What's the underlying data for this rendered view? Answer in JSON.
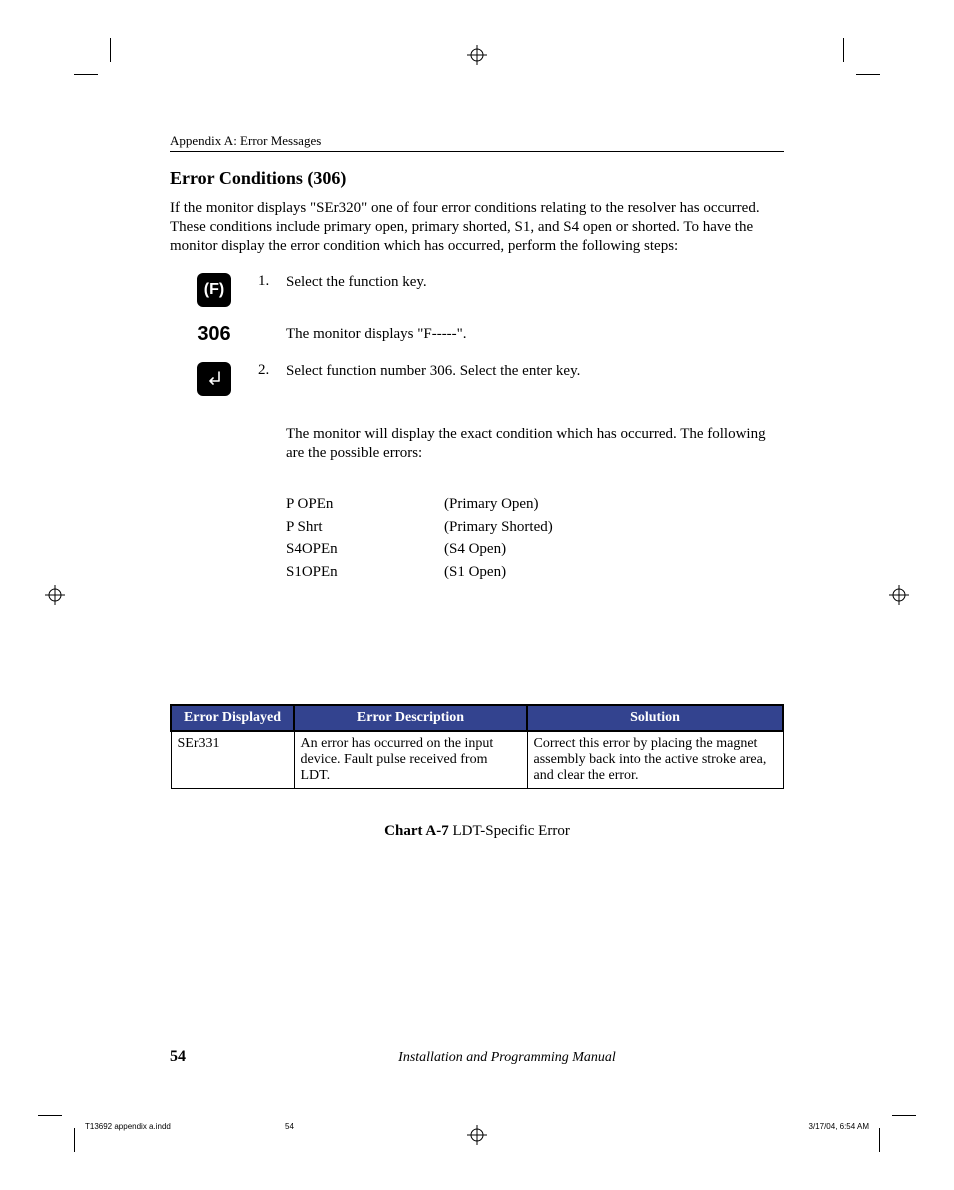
{
  "header": "Appendix A:  Error Messages",
  "section_title": "Error Conditions (306)",
  "intro": "If the monitor displays \"SEr320\" one of four error conditions relating to the resolver has occurred. These conditions include primary open, primary shorted, S1, and S4 open or shorted. To have the monitor display the error condition which has occurred, perform the following steps:",
  "icons": {
    "f_label": "(F)",
    "code_306": "306"
  },
  "steps": {
    "s1_num": "1.",
    "s1_text": "Select the function key.",
    "s1_result": "The monitor displays \"F-----\".",
    "s2_num": "2.",
    "s2_text": "Select function number 306. Select the enter key.",
    "s2_result": "The monitor will display the exact condition which has occurred. The following are the possible errors:"
  },
  "errors": [
    {
      "code": "P OPEn",
      "desc": "(Primary Open)"
    },
    {
      "code": "P Shrt",
      "desc": "(Primary Shorted)"
    },
    {
      "code": "S4OPEn",
      "desc": "(S4 Open)"
    },
    {
      "code": "S1OPEn",
      "desc": "(S1 Open)"
    }
  ],
  "table": {
    "head": {
      "c1": "Error Displayed",
      "c2": "Error Description",
      "c3": "Solution"
    },
    "row": {
      "c1": "SEr331",
      "c2": "An error has occurred on the input device.  Fault pulse received from LDT.",
      "c3": "Correct this error by placing the magnet assembly back into the active stroke area, and clear the error."
    }
  },
  "chart_caption_bold": "Chart A-7",
  "chart_caption_rest": " LDT-Specific  Error",
  "footer": {
    "page": "54",
    "title": "Installation and Programming Manual"
  },
  "slug": {
    "file": "T13692 appendix a.indd",
    "pg": "54",
    "ts": "3/17/04, 6:54 AM"
  }
}
